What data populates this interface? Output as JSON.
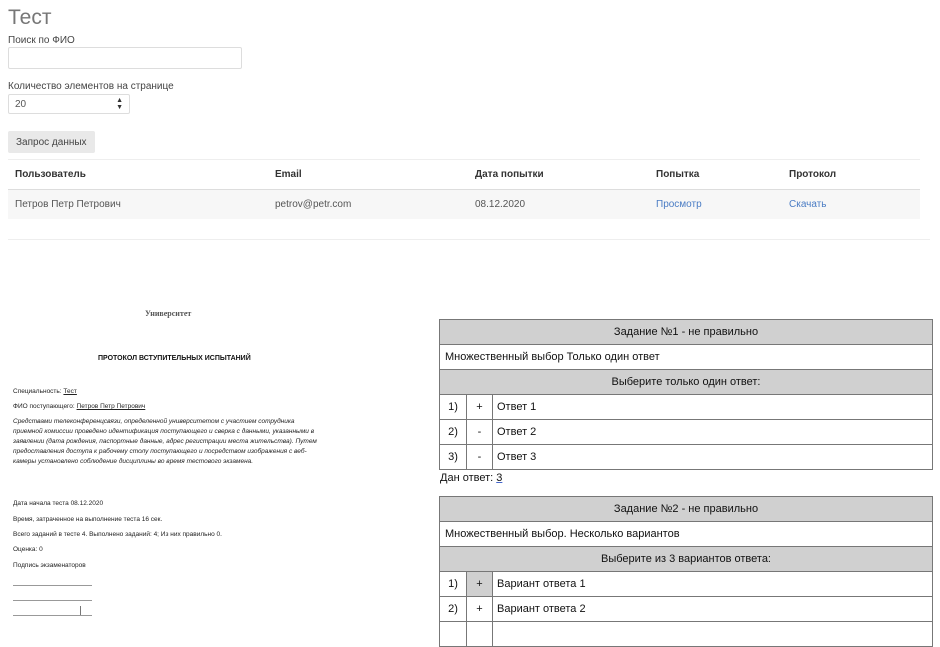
{
  "page": {
    "title": "Тест"
  },
  "search": {
    "label": "Поиск по ФИО",
    "value": "",
    "placeholder": ""
  },
  "per_page": {
    "label": "Количество элементов на странице",
    "selected": "20"
  },
  "fetch_button": {
    "label": "Запрос данных"
  },
  "table": {
    "columns": [
      "Пользователь",
      "Email",
      "Дата попытки",
      "Попытка",
      "Протокол"
    ],
    "rows": [
      {
        "user": "Петров Петр Петрович",
        "email": "petrov@petr.com",
        "date": "08.12.2020",
        "attempt": "Просмотр",
        "protocol": "Скачать"
      }
    ]
  },
  "protocol": {
    "university": "Университет",
    "title": "ПРОТОКОЛ ВСТУПИТЕЛЬНЫХ ИСПЫТАНИЙ",
    "specialty_label": "Специальность:",
    "specialty_value": "Тест",
    "applicant_label": "ФИО поступающего:",
    "applicant_value": "Петров Петр Петрович",
    "paragraph": "Средствами телеконференцсвязи, определенной университетом с участием сотрудника приемной комиссии проведено идентификация поступающего и сверка с данными, указанными в заявлении (дата рождения, паспортные данные, адрес регистрации места жительства). Путем предоставления доступа к рабочему столу поступающего и посредством изображения с веб-камеры установлено соблюдение дисциплины во время тестового экзамена.",
    "start_date": "Дата начала теста 08.12.2020",
    "time_spent": "Время, затраченное на выполнение теста 16 сек.",
    "tasks_summary": "Всего заданий в тесте 4. Выполнено заданий: 4; Из них правильно 0.",
    "score": "Оценка: 0",
    "signature": "Подпись экзаменаторов"
  },
  "tasks": [
    {
      "header": "Задание №1 - не правильно",
      "type": "Множественный выбор Только один ответ",
      "prompt": "Выберите только один ответ:",
      "options": [
        {
          "num": "1)",
          "mark": "+",
          "text": "Ответ 1"
        },
        {
          "num": "2)",
          "mark": "-",
          "text": "Ответ 2"
        },
        {
          "num": "3)",
          "mark": "-",
          "text": "Ответ 3"
        }
      ],
      "given_label": "Дан ответ:",
      "given_value": "3"
    },
    {
      "header": "Задание №2 - не правильно",
      "type": "Множественный выбор. Несколько вариантов",
      "prompt": "Выберите из 3 вариантов ответа:",
      "options": [
        {
          "num": "1)",
          "mark": "+",
          "text": "Вариант ответа 1"
        },
        {
          "num": "2)",
          "mark": "+",
          "text": "Вариант ответа 2"
        }
      ]
    }
  ]
}
